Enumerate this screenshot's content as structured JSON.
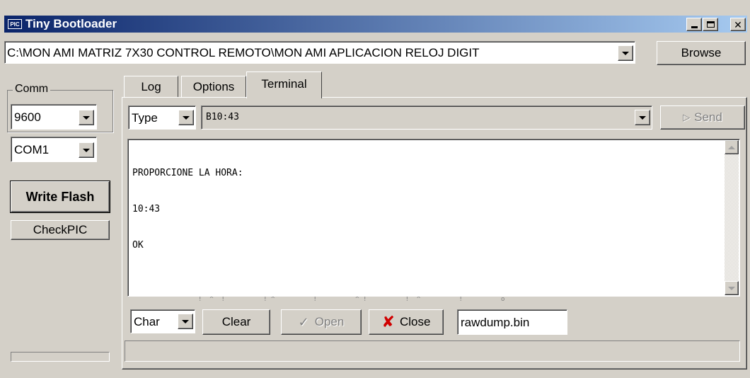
{
  "window": {
    "title": "Tiny Bootloader",
    "icon_label": "PIC"
  },
  "file": {
    "path": "C:\\MON AMI MATRIZ 7X30 CONTROL REMOTO\\MON AMI APLICACION RELOJ DIGIT",
    "browse_label": "Browse"
  },
  "comm": {
    "group_label": "Comm",
    "baud": "9600",
    "port": "COM1"
  },
  "actions": {
    "write_flash": "Write Flash",
    "check_pic": "CheckPIC"
  },
  "tabs": [
    {
      "label": "Log"
    },
    {
      "label": "Options"
    },
    {
      "label": "Terminal"
    }
  ],
  "terminal": {
    "type_select": "Type",
    "input_value": "B10:43",
    "send_label": "Send",
    "output_lines": [
      "PROPORCIONE LA HORA:",
      "10:43",
      "OK"
    ],
    "ruler_marks": "!  ^  !          ! ^          !          ^ !          !  ^          !          o",
    "char_select": "Char",
    "clear_label": "Clear",
    "open_label": "Open",
    "close_label": "Close",
    "dump_file": "rawdump.bin"
  },
  "colors": {
    "titlebar_start": "#0a246a",
    "titlebar_end": "#a6caf0",
    "face": "#d4d0c8"
  }
}
